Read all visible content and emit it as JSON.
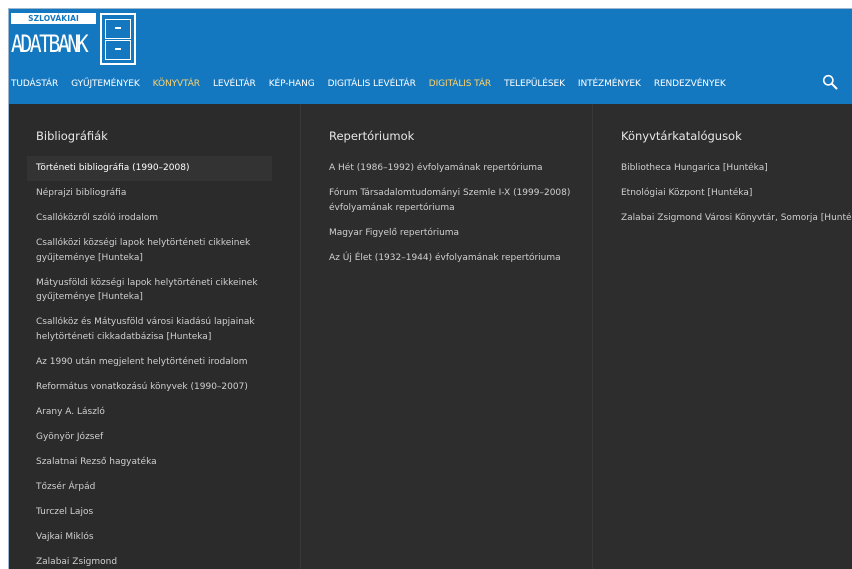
{
  "logo": {
    "tagline": "SZLOVÁKIAI MAGYAR",
    "name": "ADATBANK"
  },
  "nav": {
    "items": [
      {
        "label": "TUDÁSTÁR",
        "active": false
      },
      {
        "label": "GYŰJTEMÉNYEK",
        "active": false
      },
      {
        "label": "KÖNYVTÁR",
        "active": true
      },
      {
        "label": "LEVÉLTÁR",
        "active": false
      },
      {
        "label": "KÉP-HANG",
        "active": false
      },
      {
        "label": "DIGITÁLIS LEVÉLTÁR",
        "active": false
      },
      {
        "label": "DIGITÁLIS TÁR",
        "active": true
      },
      {
        "label": "TELEPÜLÉSEK",
        "active": false
      },
      {
        "label": "INTÉZMÉNYEK",
        "active": false
      },
      {
        "label": "RENDEZVÉNYEK",
        "active": false
      }
    ],
    "search_icon": "search-icon",
    "active_color": "#ffd36a",
    "header_color": "#1478c0"
  },
  "menu": {
    "bibliographies": {
      "title": "Bibliográfiák",
      "items": [
        "Történeti bibliográfia (1990–2008)",
        "Néprajzi bibliográfia",
        "Csallóközről szóló irodalom",
        "Csallóközi községi lapok helytörténeti cikkeinek gyűjteménye [Hunteka]",
        "Mátyusföldi községi lapok helytörténeti cikkeinek gyűjteménye [Hunteka]",
        "Csallóköz és Mátyusföld városi kiadású lapjainak helytörténeti cikkadatbázisa [Hunteka]",
        "Az 1990 után megjelent helytörténeti irodalom",
        "Református vonatkozású könyvek (1990–2007)",
        "Arany A. László",
        "Gyönyör József",
        "Szalatnai Rezső hagyatéka",
        "Tőzsér Árpád",
        "Turczel Lajos",
        "Vajkai Miklós",
        "Zalabai Zsigmond"
      ]
    },
    "repertories": {
      "title": "Repertóriumok",
      "items": [
        "A Hét (1986–1992) évfolyamának repertóriuma",
        "Fórum Társadalomtudományi Szemle I-X (1999–2008) évfolyamának repertóriuma",
        "Magyar Figyelő repertóriuma",
        "Az Új Élet (1932–1944) évfolyamának repertóriuma"
      ]
    },
    "catalogues": {
      "title": "Könyvtárkatalógusok",
      "items": [
        "Bibliotheca Hungarica [Huntéka]",
        "Etnológiai Központ [Huntéka]",
        "Zalabai Zsigmond Városi Könyvtár, Somorja [Huntéka]"
      ]
    }
  }
}
